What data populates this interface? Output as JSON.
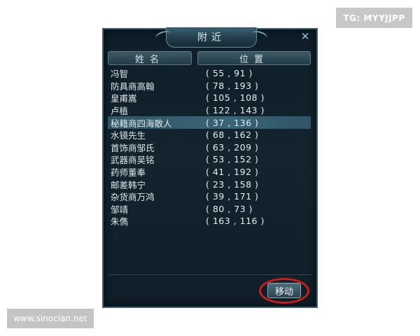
{
  "badges": {
    "top_right": "TG: MYYJJPP",
    "bottom_left": "www.sinoclan.net"
  },
  "window": {
    "title": "附近",
    "close_icon": "close-icon",
    "columns": {
      "name": "姓名",
      "position": "位置"
    },
    "rows": [
      {
        "name": "冯智",
        "position": "( 55 , 91 )"
      },
      {
        "name": "防具商高翰",
        "position": "( 78 , 193 )"
      },
      {
        "name": "皇甫嵩",
        "position": "( 105 , 108 )"
      },
      {
        "name": "卢植",
        "position": "( 122 , 143 )"
      },
      {
        "name": "秘籍商四海散人",
        "position": "( 37 , 136 )",
        "selected": true
      },
      {
        "name": "水镜先生",
        "position": "( 68 , 162 )"
      },
      {
        "name": "首饰商邹氏",
        "position": "( 63 , 209 )"
      },
      {
        "name": "武器商吴铭",
        "position": "( 53 , 152 )"
      },
      {
        "name": "药师董奉",
        "position": "( 41 , 192 )"
      },
      {
        "name": "邮差韩宁",
        "position": "( 23 , 158 )"
      },
      {
        "name": "杂货商万鸿",
        "position": "( 39 , 171 )"
      },
      {
        "name": "邹靖",
        "position": "( 80 , 73 )"
      },
      {
        "name": "朱儁",
        "position": "( 163 , 116 )"
      }
    ],
    "move_button": "移动"
  },
  "colors": {
    "highlight": "#d11a1a",
    "selected_row": "#3a6476",
    "panel_bg": "#13242f"
  }
}
